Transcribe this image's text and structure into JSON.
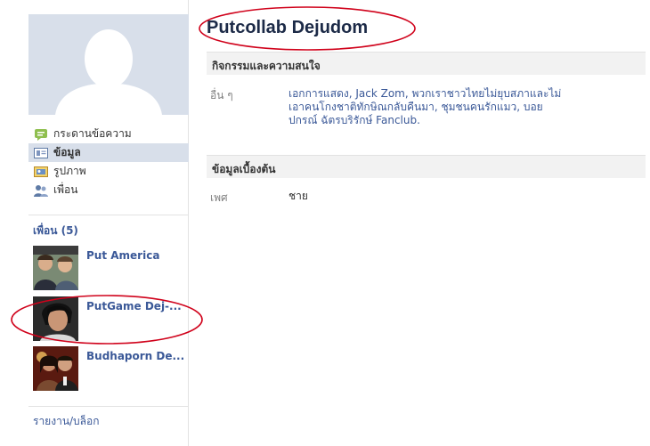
{
  "profile": {
    "name": "Putcollab Dejudom"
  },
  "nav": {
    "items": [
      {
        "label": "กระดานข้อความ",
        "icon": "wall-icon"
      },
      {
        "label": "ข้อมูล",
        "icon": "info-icon",
        "active": true
      },
      {
        "label": "รูปภาพ",
        "icon": "photos-icon"
      },
      {
        "label": "เพื่อน",
        "icon": "friends-icon"
      }
    ]
  },
  "friends": {
    "title": "เพื่อน (5)",
    "list": [
      {
        "name": "Put America"
      },
      {
        "name": "PutGame Dej-..."
      },
      {
        "name": "Budhaporn De..."
      }
    ]
  },
  "report_link": "รายงาน/บล็อก",
  "sections": {
    "activities": {
      "title": "กิจกรรมและความสนใจ",
      "label": "อื่น ๆ",
      "value": "เอกการแสดง, Jack Zom, พวกเราชาวไทยไม่ยุบสภาและไม่เอาคนโกงชาติทักษิณกลับคืนมา, ชุมชนคนรักแมว, บอย ปกรณ์ ฉัตรบริรักษ์ Fanclub."
    },
    "basic": {
      "title": "ข้อมูลเบื้องต้น",
      "label": "เพศ",
      "value": "ชาย"
    }
  },
  "colors": {
    "link": "#3b5998",
    "annotation": "#d0021b",
    "header_bg": "#f2f2f2"
  }
}
